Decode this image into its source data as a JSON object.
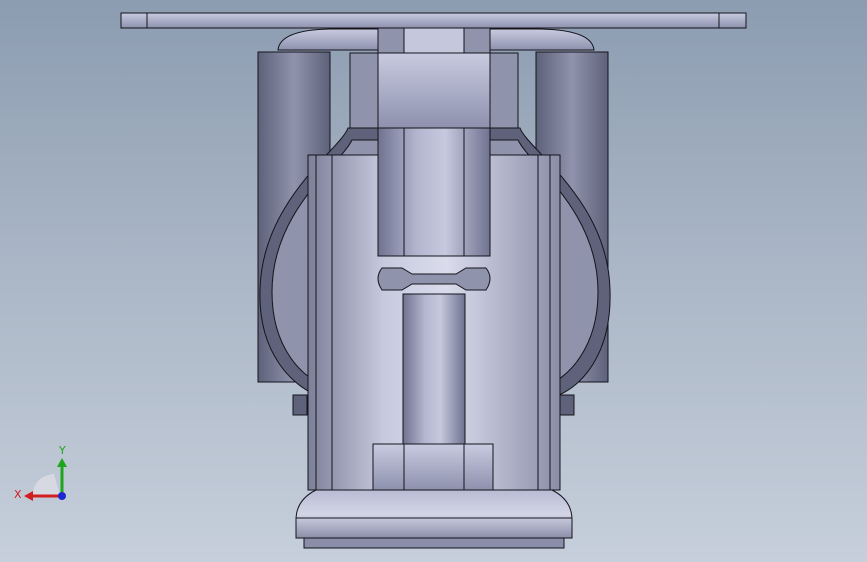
{
  "viewport": {
    "background_top": "#8c9cb1",
    "background_bottom": "#c6cfdb"
  },
  "model": {
    "component": "caster-wheel-assembly",
    "view": "front",
    "shading_color": "#9ea2bd",
    "edge_color": "#14141c"
  },
  "triad": {
    "x_label": "X",
    "y_label": "Y",
    "x_color": "#d21e1e",
    "y_color": "#1ea51e",
    "z_color": "#1e28d2"
  }
}
